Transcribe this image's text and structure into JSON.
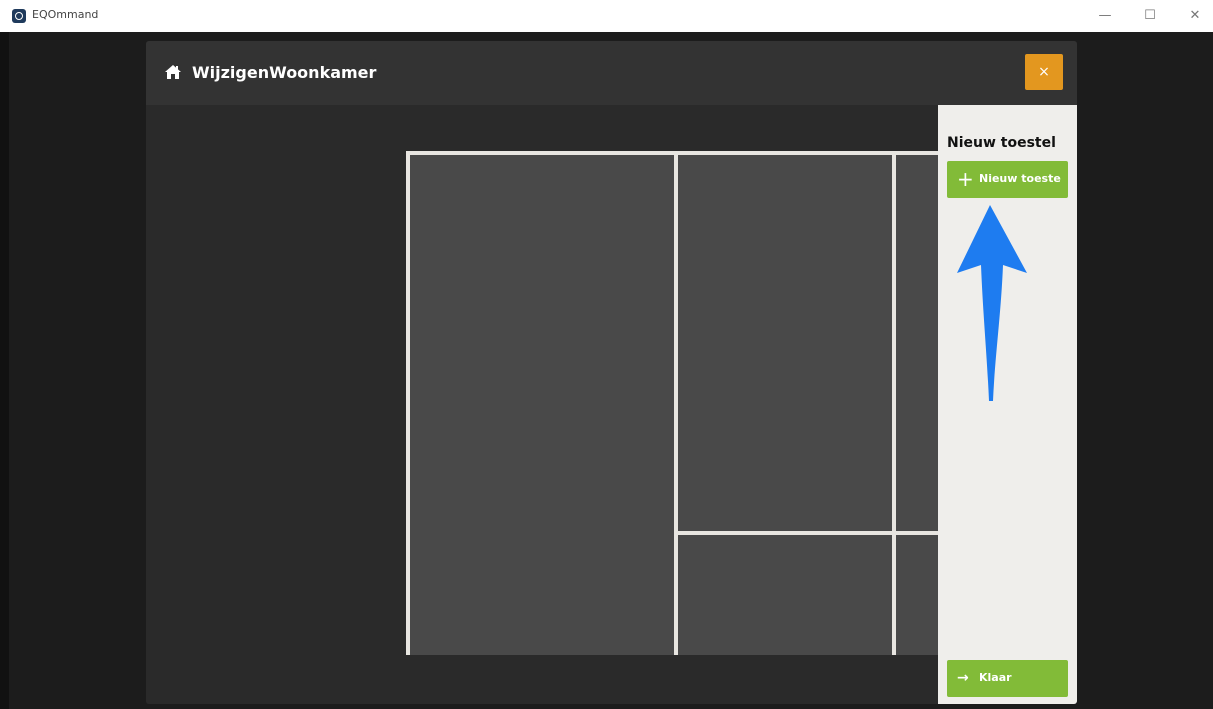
{
  "window": {
    "app_title": "EQOmmand",
    "controls": {
      "minimize": "—",
      "maximize": "☐",
      "close": "✕"
    }
  },
  "dialog": {
    "icon": "home-icon",
    "title": "WijzigenWoonkamer",
    "close_label": "×"
  },
  "panel": {
    "title": "Nieuw toestel",
    "new_device": {
      "icon": "plus-icon",
      "label": "Nieuw toeste"
    },
    "done": {
      "icon": "arrow-right-icon",
      "label": "Klaar"
    }
  },
  "colors": {
    "accent_orange": "#e3971f",
    "accent_green": "#82bb38",
    "annotation_blue": "#1e7cf0",
    "background_dark": "#2c2c2c",
    "panel_bg": "#efeeeb"
  }
}
